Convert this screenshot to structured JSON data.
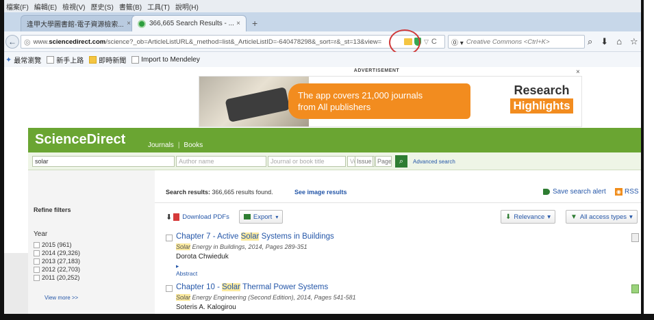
{
  "menubar": [
    "檔案(F)",
    "編輯(E)",
    "檢視(V)",
    "歷史(S)",
    "書籤(B)",
    "工具(T)",
    "說明(H)"
  ],
  "tabs": [
    {
      "label": "逢甲大學圖書館-電子資源檢索...",
      "close": "×"
    },
    {
      "label": "366,665 Search Results - ...",
      "close": "×"
    }
  ],
  "newtab": "+",
  "nav": {
    "back": "←",
    "url_prefix": "www.",
    "url_domain": "sciencedirect.com",
    "url_rest": "/science?_ob=ArticleListURL&_method=list&_ArticleListID=-640478298&_sort=r&_st=13&view=",
    "search_engine": "Creative Commons <Ctrl+K>",
    "search_prefix": "⓪ ▾"
  },
  "bookmarks": [
    "最常瀏覽",
    "新手上路",
    "即時新聞",
    "Import to Mendeley"
  ],
  "ad": {
    "label": "ADVERTISEMENT",
    "close": "×",
    "line1": "The app covers 21,000 journals",
    "line2": "from All publishers",
    "brand1": "Research",
    "brand2": "Highlights"
  },
  "sd": {
    "logo": "ScienceDirect",
    "nav_journals": "Journals",
    "nav_sep": "|",
    "nav_books": "Books",
    "search_value": "solar",
    "author_placeholder": "Author name",
    "journal_placeholder": "Journal or book title",
    "volume_placeholder": "Volume",
    "issue_placeholder": "Issue",
    "page_placeholder": "Page",
    "advanced": "Advanced search"
  },
  "filters": {
    "refine": "Refine filters",
    "year_title": "Year",
    "years": [
      "2015 (961)",
      "2014 (29,326)",
      "2013 (27,183)",
      "2012 (22,703)",
      "2011 (20,252)"
    ],
    "view_more": "View more >>"
  },
  "results": {
    "label": "Search results:",
    "count_text": "366,665 results found.",
    "image_results": "See image results",
    "save_alert": "Save search alert",
    "rss": "RSS",
    "download_pdfs": "Download PDFs",
    "export": "Export",
    "relevance": "Relevance",
    "access": "All access types",
    "items": [
      {
        "title_pre": "Chapter 7 - Active ",
        "title_hl": "Solar",
        "title_post": " Systems in Buildings",
        "src_hl": "Solar",
        "src_post": " Energy in Buildings, 2014, Pages 289-351",
        "author": "Dorota Chwieduk",
        "abstract": "▸ Abstract"
      },
      {
        "title_pre": "Chapter 10 - ",
        "title_hl": "Solar",
        "title_post": " Thermal Power Systems",
        "src_hl": "Solar",
        "src_post": " Energy Engineering (Second Edition), 2014, Pages 541-581",
        "author": "Soteris A. Kalogirou"
      }
    ]
  }
}
